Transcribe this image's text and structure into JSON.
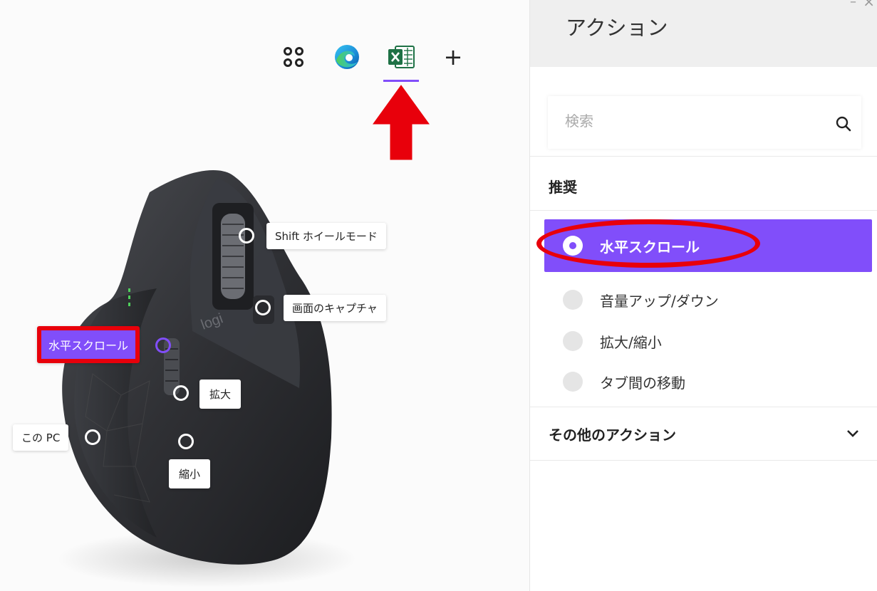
{
  "app_tabs": [
    {
      "name": "all-apps",
      "icon": "grid-icon"
    },
    {
      "name": "edge",
      "icon": "edge-icon"
    },
    {
      "name": "excel",
      "icon": "excel-icon",
      "selected": true
    },
    {
      "name": "add",
      "icon": "plus-icon",
      "label": "+"
    }
  ],
  "mouse": {
    "brand": "logi",
    "callouts": {
      "shift_wheel": "Shift ホイールモード",
      "capture": "画面のキャプチャ",
      "hscroll": "水平スクロール",
      "zoom_in": "拡大",
      "this_pc": "この PC",
      "zoom_out": "縮小"
    }
  },
  "panel": {
    "title": "アクション",
    "window_min": "–",
    "window_close": "×",
    "search_placeholder": "検索",
    "section_recommended": "推奨",
    "options": [
      {
        "label": "水平スクロール",
        "selected": true
      },
      {
        "label": "音量アップ/ダウン",
        "selected": false
      },
      {
        "label": "拡大/縮小",
        "selected": false
      },
      {
        "label": "タブ間の移動",
        "selected": false
      }
    ],
    "other_actions": "その他のアクション"
  },
  "colors": {
    "accent": "#814efa",
    "highlight_red": "#e8000b"
  }
}
